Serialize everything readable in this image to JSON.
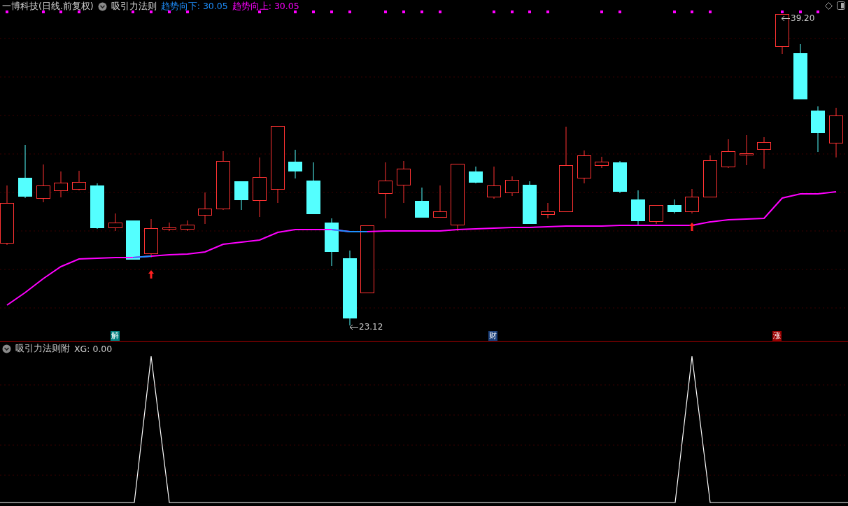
{
  "header": {
    "security": "一博科技(日线.前复权)",
    "indicator": "吸引力法则",
    "readings": [
      {
        "label": "趋势向下: 30.05",
        "color": "#1e90ff"
      },
      {
        "label": "趋势向上: 30.05",
        "color": "#ff00ff"
      }
    ]
  },
  "price_labels": [
    {
      "text": "39.20"
    },
    {
      "text": "23.12"
    }
  ],
  "event_badges": [
    {
      "text": "解",
      "color": "#007f7f"
    },
    {
      "text": "财",
      "color": "#1a3f7a"
    },
    {
      "text": "涨",
      "color": "#9a0000"
    }
  ],
  "sub_panel": {
    "indicator": "吸引力法则附",
    "reading": "XG: 0.00"
  }
}
